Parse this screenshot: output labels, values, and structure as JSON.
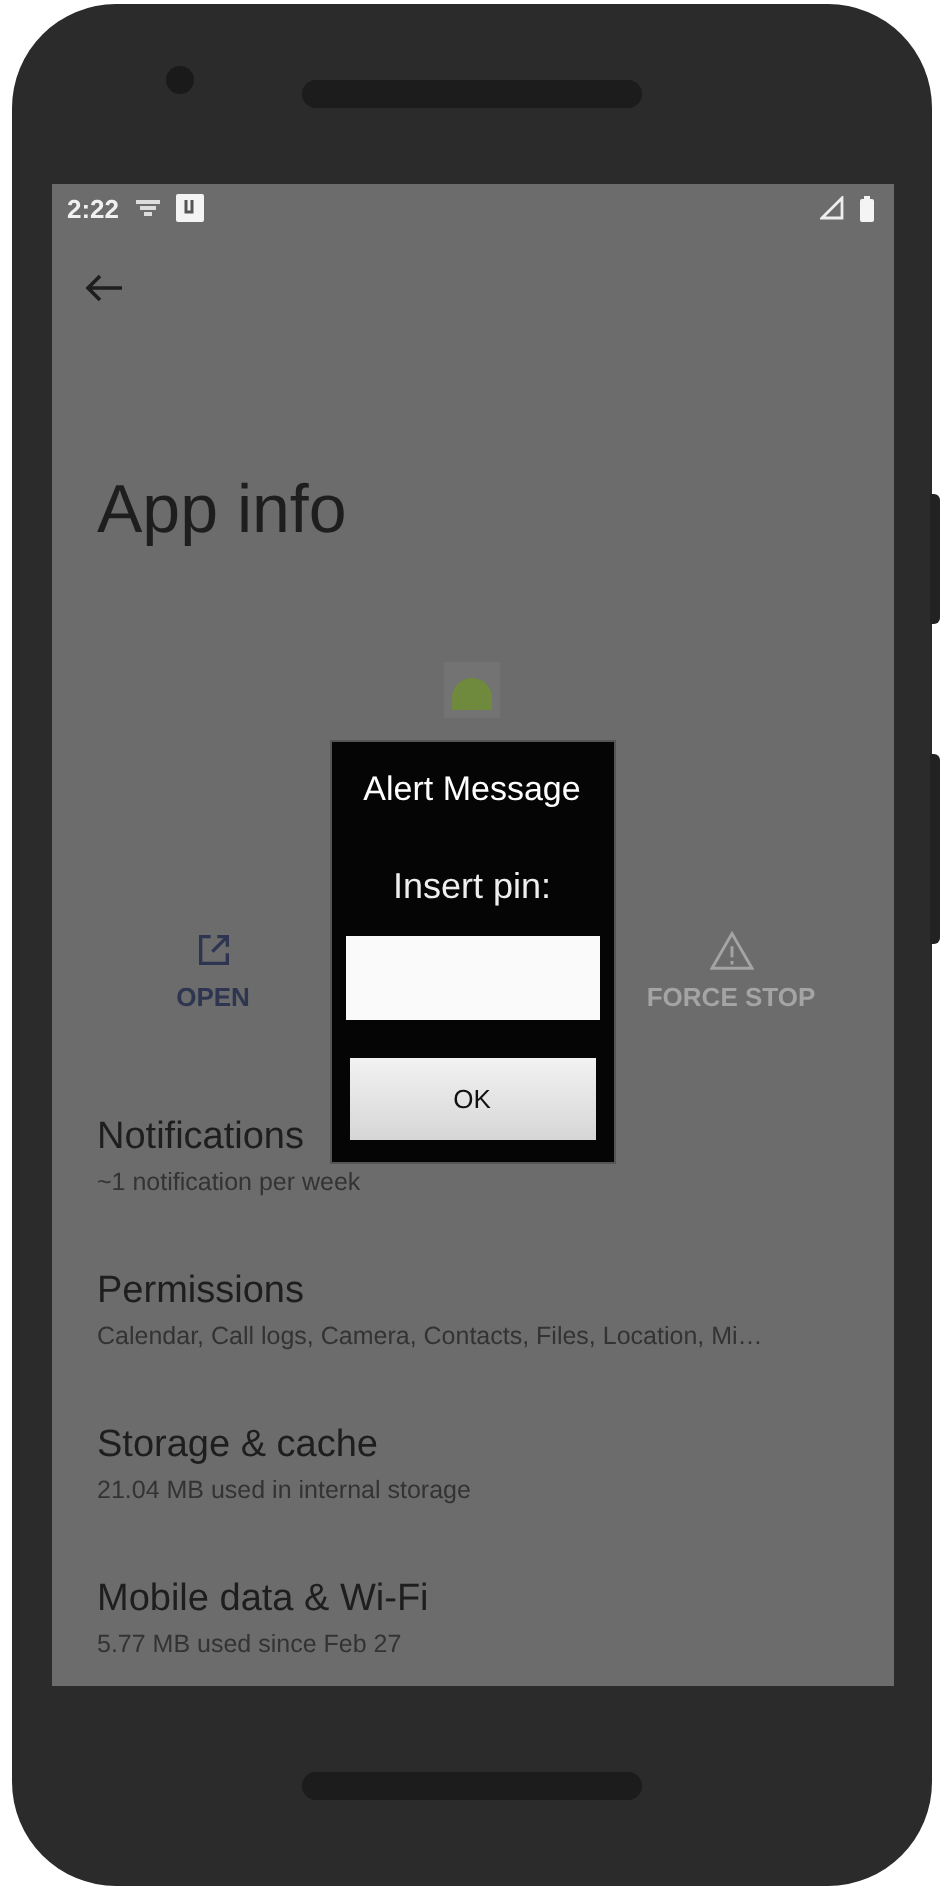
{
  "status_bar": {
    "time": "2:22"
  },
  "page": {
    "title": "App info"
  },
  "actions": [
    {
      "label": "OPEN",
      "kind": "open",
      "disabled": false
    },
    {
      "label": "FORCE STOP",
      "kind": "stop",
      "disabled": true
    }
  ],
  "settings": [
    {
      "title": "Notifications",
      "subtitle": "~1 notification per week"
    },
    {
      "title": "Permissions",
      "subtitle": "Calendar, Call logs, Camera, Contacts, Files, Location, Mi…"
    },
    {
      "title": "Storage & cache",
      "subtitle": "21.04 MB used in internal storage"
    },
    {
      "title": "Mobile data & Wi-Fi",
      "subtitle": "5.77 MB used since Feb 27"
    }
  ],
  "dialog": {
    "title": "Alert Message",
    "message": "Insert pin:",
    "button": "OK"
  }
}
